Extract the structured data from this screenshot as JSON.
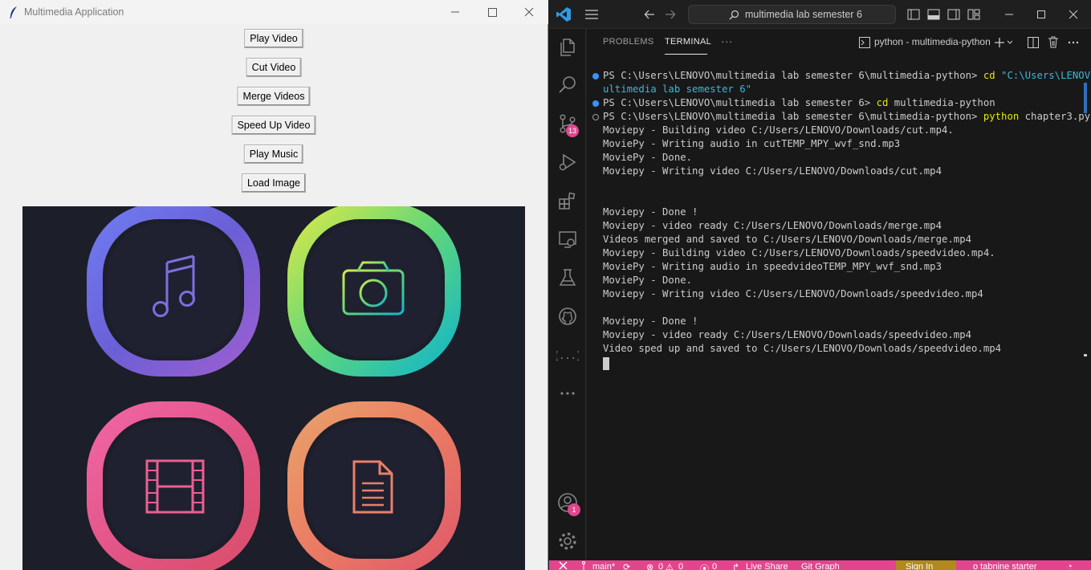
{
  "tk": {
    "title": "Multimedia Application",
    "buttons": [
      "Play Video",
      "Cut Video",
      "Merge Videos",
      "Speed Up Video",
      "Play Music",
      "Load Image"
    ]
  },
  "vscode": {
    "search_text": "multimedia lab semester 6",
    "panel_tabs": {
      "problems": "PROBLEMS",
      "terminal": "TERMINAL",
      "more": "···"
    },
    "terminal_name": "python - multimedia-python",
    "badges": {
      "source_control": "13",
      "accounts": "1"
    },
    "terminal_lines": [
      {
        "segments": [
          {
            "text": "PS C:\\Users\\LENOVO\\multimedia lab semester 6\\multimedia-python> "
          },
          {
            "text": "cd ",
            "color": "yellow"
          },
          {
            "text": "\"C:\\Users\\LENOVO\\m",
            "color": "cyan"
          }
        ],
        "dot": "blue"
      },
      {
        "segments": [
          {
            "text": "ultimedia lab semester 6\"",
            "color": "cyan"
          }
        ]
      },
      {
        "segments": [
          {
            "text": "PS C:\\Users\\LENOVO\\multimedia lab semester 6> "
          },
          {
            "text": "cd ",
            "color": "yellow"
          },
          {
            "text": "multimedia-python"
          }
        ],
        "dot": "blue"
      },
      {
        "segments": [
          {
            "text": "PS C:\\Users\\LENOVO\\multimedia lab semester 6\\multimedia-python> "
          },
          {
            "text": "python ",
            "color": "yellow"
          },
          {
            "text": "chapter3.py"
          }
        ],
        "dot": "hollow"
      },
      {
        "segments": [
          {
            "text": "Moviepy - Building video C:/Users/LENOVO/Downloads/cut.mp4."
          }
        ]
      },
      {
        "segments": [
          {
            "text": "MoviePy - Writing audio in cutTEMP_MPY_wvf_snd.mp3"
          }
        ]
      },
      {
        "segments": [
          {
            "text": "MoviePy - Done."
          }
        ]
      },
      {
        "segments": [
          {
            "text": "Moviepy - Writing video C:/Users/LENOVO/Downloads/cut.mp4"
          }
        ]
      },
      {
        "segments": [
          {
            "text": ""
          }
        ]
      },
      {
        "segments": [
          {
            "text": ""
          }
        ]
      },
      {
        "segments": [
          {
            "text": "Moviepy - Done !"
          }
        ]
      },
      {
        "segments": [
          {
            "text": "Moviepy - video ready C:/Users/LENOVO/Downloads/merge.mp4"
          }
        ]
      },
      {
        "segments": [
          {
            "text": "Videos merged and saved to C:/Users/LENOVO/Downloads/merge.mp4"
          }
        ]
      },
      {
        "segments": [
          {
            "text": "Moviepy - Building video C:/Users/LENOVO/Downloads/speedvideo.mp4."
          }
        ]
      },
      {
        "segments": [
          {
            "text": "MoviePy - Writing audio in speedvideoTEMP_MPY_wvf_snd.mp3"
          }
        ]
      },
      {
        "segments": [
          {
            "text": "MoviePy - Done."
          }
        ]
      },
      {
        "segments": [
          {
            "text": "Moviepy - Writing video C:/Users/LENOVO/Downloads/speedvideo.mp4"
          }
        ]
      },
      {
        "segments": [
          {
            "text": ""
          }
        ]
      },
      {
        "segments": [
          {
            "text": "Moviepy - Done !"
          }
        ]
      },
      {
        "segments": [
          {
            "text": "Moviepy - video ready C:/Users/LENOVO/Downloads/speedvideo.mp4"
          }
        ]
      },
      {
        "segments": [
          {
            "text": "Video sped up and saved to C:/Users/LENOVO/Downloads/speedvideo.mp4"
          }
        ]
      }
    ],
    "statusbar": {
      "branch": "main*",
      "errors": "0",
      "warnings": "0",
      "ports": "0",
      "live_share": "Live Share",
      "git_graph": "Git Graph",
      "sign_in": "Sign In",
      "extra": "o tabnine starter"
    }
  },
  "colors": {
    "accent_pink": "#e2458e",
    "terminal_bg": "#181818",
    "yellow": "#e5e510",
    "cyan": "#3fb6d6",
    "dot_blue": "#3794ff"
  }
}
